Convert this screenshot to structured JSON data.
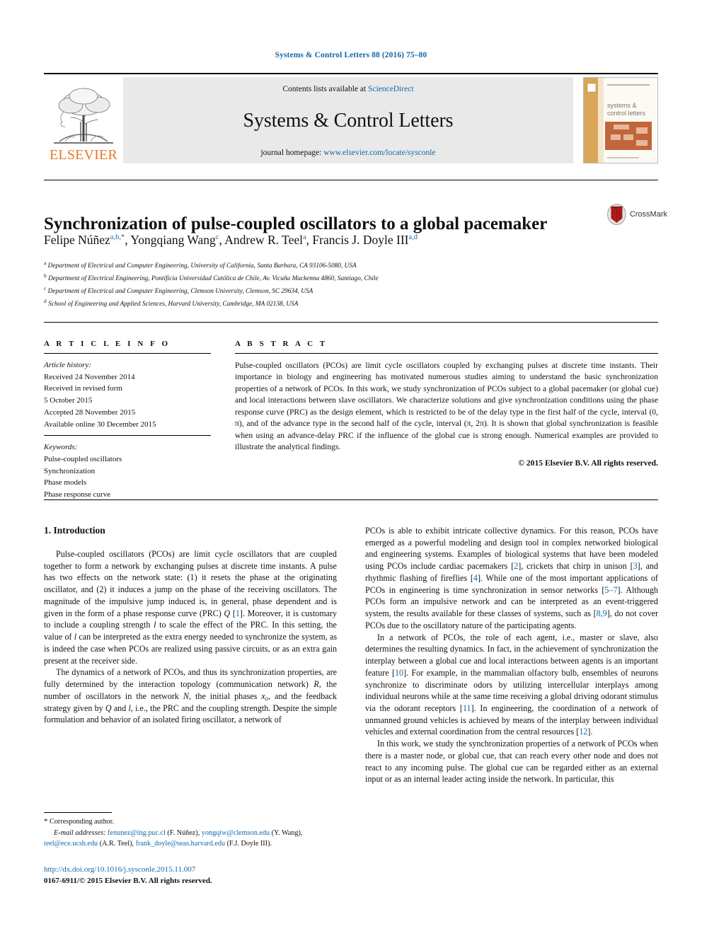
{
  "running_head": "Systems & Control Letters 88 (2016) 75–80",
  "masthead": {
    "publisher_logo_name": "ELSEVIER",
    "contents_prefix": "Contents lists available at ",
    "contents_link": "ScienceDirect",
    "journal_title": "Systems & Control Letters",
    "homepage_prefix": "journal homepage: ",
    "homepage_url": "www.elsevier.com/locate/sysconle",
    "cover_line1": "systems &",
    "cover_line2": "control letters"
  },
  "article": {
    "title": "Synchronization of pulse-coupled oscillators to a global pacemaker",
    "crossmark_label": "CrossMark",
    "authors": [
      {
        "name": "Felipe Núñez",
        "marks": "a,b,",
        "star": true
      },
      {
        "name": "Yongqiang Wang",
        "marks": "c",
        "star": false
      },
      {
        "name": "Andrew R. Teel",
        "marks": "a",
        "star": false
      },
      {
        "name": "Francis J. Doyle III",
        "marks": "a,d",
        "star": false
      }
    ],
    "affiliations": [
      {
        "mark": "a",
        "text": "Department of Electrical and Computer Engineering, University of California, Santa Barbara, CA 93106-5080, USA"
      },
      {
        "mark": "b",
        "text": "Department of Electrical Engineering, Pontificia Universidad Católica de Chile, Av. Vicuña Mackenna 4860, Santiago, Chile"
      },
      {
        "mark": "c",
        "text": "Department of Electrical and Computer Engineering, Clemson University, Clemson, SC 29634, USA"
      },
      {
        "mark": "d",
        "text": "School of Engineering and Applied Sciences, Harvard University, Cambridge, MA 02138, USA"
      }
    ]
  },
  "article_info": {
    "heading": "A R T I C L E  I N F O",
    "history_label": "Article history:",
    "history": [
      "Received 24 November 2014",
      "Received in revised form",
      "5 October 2015",
      "Accepted 28 November 2015",
      "Available online 30 December 2015"
    ],
    "keywords_label": "Keywords:",
    "keywords": [
      "Pulse-coupled oscillators",
      "Synchronization",
      "Phase models",
      "Phase response curve"
    ]
  },
  "abstract": {
    "heading": "A B S T R A C T",
    "text": "Pulse-coupled oscillators (PCOs) are limit cycle oscillators coupled by exchanging pulses at discrete time instants. Their importance in biology and engineering has motivated numerous studies aiming to understand the basic synchronization properties of a network of PCOs. In this work, we study synchronization of PCOs subject to a global pacemaker (or global cue) and local interactions between slave oscillators. We characterize solutions and give synchronization conditions using the phase response curve (PRC) as the design element, which is restricted to be of the delay type in the first half of the cycle, interval (0, π), and of the advance type in the second half of the cycle, interval (π, 2π). It is shown that global synchronization is feasible when using an advance-delay PRC if the influence of the global cue is strong enough. Numerical examples are provided to illustrate the analytical findings.",
    "copyright": "© 2015 Elsevier B.V. All rights reserved."
  },
  "body": {
    "section_heading": "1. Introduction",
    "left_paragraphs": [
      "Pulse-coupled oscillators (PCOs) are limit cycle oscillators that are coupled together to form a network by exchanging pulses at discrete time instants. A pulse has two effects on the network state: (1) it resets the phase at the originating oscillator, and (2) it induces a jump on the phase of the receiving oscillators. The magnitude of the impulsive jump induced is, in general, phase dependent and is given in the form of a phase response curve (PRC) Q [1]. Moreover, it is customary to include a coupling strength l to scale the effect of the PRC. In this setting, the value of l can be interpreted as the extra energy needed to synchronize the system, as is indeed the case when PCOs are realized using passive circuits, or as an extra gain present at the receiver side.",
      "The dynamics of a network of PCOs, and thus its synchronization properties, are fully determined by the interaction topology (communication network) R, the number of oscillators in the network N, the initial phases x₀, and the feedback strategy given by Q and l, i.e., the PRC and the coupling strength. Despite the simple formulation and behavior of an isolated firing oscillator, a network of"
    ],
    "right_paragraphs": [
      "PCOs is able to exhibit intricate collective dynamics. For this reason, PCOs have emerged as a powerful modeling and design tool in complex networked biological and engineering systems. Examples of biological systems that have been modeled using PCOs include cardiac pacemakers [2], crickets that chirp in unison [3], and rhythmic flashing of fireflies [4]. While one of the most important applications of PCOs in engineering is time synchronization in sensor networks [5–7]. Although PCOs form an impulsive network and can be interpreted as an event-triggered system, the results available for these classes of systems, such as [8,9], do not cover PCOs due to the oscillatory nature of the participating agents.",
      "In a network of PCOs, the role of each agent, i.e., master or slave, also determines the resulting dynamics. In fact, in the achievement of synchronization the interplay between a global cue and local interactions between agents is an important feature [10]. For example, in the mammalian olfactory bulb, ensembles of neurons synchronize to discriminate odors by utilizing intercellular interplays among individual neurons while at the same time receiving a global driving odorant stimulus via the odorant receptors [11]. In engineering, the coordination of a network of unmanned ground vehicles is achieved by means of the interplay between individual vehicles and external coordination from the central resources [12].",
      "In this work, we study the synchronization properties of a network of PCOs when there is a master node, or global cue, that can reach every other node and does not react to any incoming pulse. The global cue can be regarded either as an external input or as an internal leader acting inside the network. In particular, this"
    ]
  },
  "footnotes": {
    "corresponding": "Corresponding author.",
    "email_label": "E-mail addresses:",
    "emails": [
      {
        "address": "fenunez@ing.puc.cl",
        "owner": "(F. Núñez)"
      },
      {
        "address": "yongqiw@clemson.edu",
        "owner": "(Y. Wang)"
      },
      {
        "address": "teel@ece.ucsb.edu",
        "owner": "(A.R. Teel)"
      },
      {
        "address": "frank_doyle@seas.harvard.edu",
        "owner": "(F.J. Doyle III)"
      }
    ],
    "doi": "http://dx.doi.org/10.1016/j.sysconle.2015.11.007",
    "issn_line": "0167-6911/© 2015 Elsevier B.V. All rights reserved."
  },
  "colors": {
    "link": "#1268a8",
    "elsevier_orange": "#e87722",
    "band_gray": "#e9e9e9"
  }
}
